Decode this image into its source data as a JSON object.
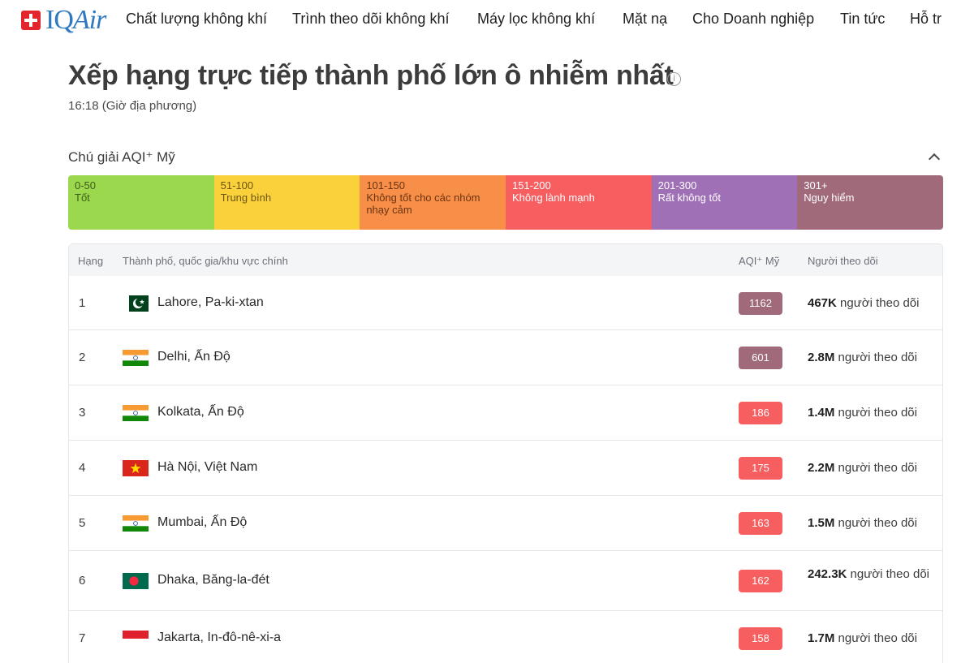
{
  "brand": {
    "name": "IQAir"
  },
  "nav": {
    "items": [
      "Chất lượng không khí",
      "Trình theo dõi không khí",
      "Máy lọc không khí",
      "Mặt nạ",
      "Cho Doanh nghiệp",
      "Tin tức",
      "Hỗ tr"
    ]
  },
  "page": {
    "title": "Xếp hạng trực tiếp thành phố lớn ô nhiễm nhất",
    "info_icon": "i",
    "local_time": "16:18 (Giờ địa phương)"
  },
  "legend": {
    "title": "Chú giải AQI⁺ Mỹ",
    "toggle_icon": "chevron-up-icon",
    "segments": [
      {
        "range": "0-50",
        "label": "Tốt",
        "color": "#9cd84e",
        "text_color": "#3d5a1a"
      },
      {
        "range": "51-100",
        "label": "Trung bình",
        "color": "#fad13b",
        "text_color": "#6b5510"
      },
      {
        "range": "101-150",
        "label": "Không tốt cho các nhóm nhạy cảm",
        "color": "#f88f48",
        "text_color": "#6a3310"
      },
      {
        "range": "151-200",
        "label": "Không lành mạnh",
        "color": "#f65e5f",
        "text_color": "#ffffff"
      },
      {
        "range": "201-300",
        "label": "Rất không tốt",
        "color": "#a070b6",
        "text_color": "#ffffff"
      },
      {
        "range": "301+",
        "label": "Nguy hiểm",
        "color": "#a06a7b",
        "text_color": "#ffffff"
      }
    ]
  },
  "table": {
    "headers": {
      "rank": "Hạng",
      "city": "Thành phố, quốc gia/khu vực chính",
      "aqi": "AQI⁺ Mỹ",
      "followers": "Người theo dõi"
    },
    "rows": [
      {
        "rank": "1",
        "city": "Lahore, Pa-ki-xtan",
        "flag": "pakistan",
        "aqi": "1162",
        "aqi_color": "#a06a7b",
        "followers_count": "467K",
        "followers_suffix": "người theo dõi"
      },
      {
        "rank": "2",
        "city": "Delhi, Ấn Độ",
        "flag": "india",
        "aqi": "601",
        "aqi_color": "#a06a7b",
        "followers_count": "2.8M",
        "followers_suffix": "người theo dõi"
      },
      {
        "rank": "3",
        "city": "Kolkata, Ấn Độ",
        "flag": "india",
        "aqi": "186",
        "aqi_color": "#f65e5f",
        "followers_count": "1.4M",
        "followers_suffix": "người theo dõi"
      },
      {
        "rank": "4",
        "city": "Hà Nội, Việt Nam",
        "flag": "vietnam",
        "aqi": "175",
        "aqi_color": "#f65e5f",
        "followers_count": "2.2M",
        "followers_suffix": "người theo dõi"
      },
      {
        "rank": "5",
        "city": "Mumbai, Ấn Độ",
        "flag": "india",
        "aqi": "163",
        "aqi_color": "#f65e5f",
        "followers_count": "1.5M",
        "followers_suffix": "người theo dõi"
      },
      {
        "rank": "6",
        "city": "Dhaka, Băng-la-đét",
        "flag": "bangladesh",
        "aqi": "162",
        "aqi_color": "#f65e5f",
        "followers_count": "242.3K",
        "followers_suffix": "người theo dõi"
      },
      {
        "rank": "7",
        "city": "Jakarta, In-đô-nê-xi-a",
        "flag": "indonesia",
        "aqi": "158",
        "aqi_color": "#f65e5f",
        "followers_count": "1.7M",
        "followers_suffix": "người theo dõi"
      }
    ]
  }
}
